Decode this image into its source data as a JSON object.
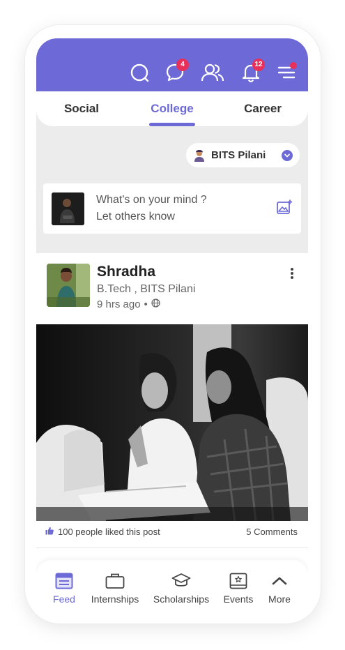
{
  "header": {
    "icons": [
      "search-icon",
      "chat-icon",
      "people-icon",
      "bell-icon",
      "menu-icon"
    ],
    "chat_badge": "4",
    "notification_badge": "12"
  },
  "tabs": [
    {
      "label": "Social",
      "active": false
    },
    {
      "label": "College",
      "active": true
    },
    {
      "label": "Career",
      "active": false
    }
  ],
  "college_selector": {
    "label": "BITS Pilani"
  },
  "composer": {
    "line1": "What's on your mind ?",
    "line2": "Let others know",
    "icon": "add-image-icon"
  },
  "post": {
    "author": "Shradha",
    "subtitle": "B.Tech , BITS Pilani",
    "time": "9 hrs ago",
    "time_separator": "•",
    "likes_text": "100 people liked this post",
    "comments_text": "5 Comments"
  },
  "bottom_nav": [
    {
      "label": "Feed",
      "icon": "feed-icon",
      "active": true
    },
    {
      "label": "Internships",
      "icon": "briefcase-icon",
      "active": false
    },
    {
      "label": "Scholarships",
      "icon": "graduation-cap-icon",
      "active": false
    },
    {
      "label": "Events",
      "icon": "event-star-icon",
      "active": false
    },
    {
      "label": "More",
      "icon": "chevron-up-icon",
      "active": false
    }
  ],
  "colors": {
    "accent": "#6d6ad8",
    "badge": "#e8305a",
    "background": "#ececec"
  }
}
